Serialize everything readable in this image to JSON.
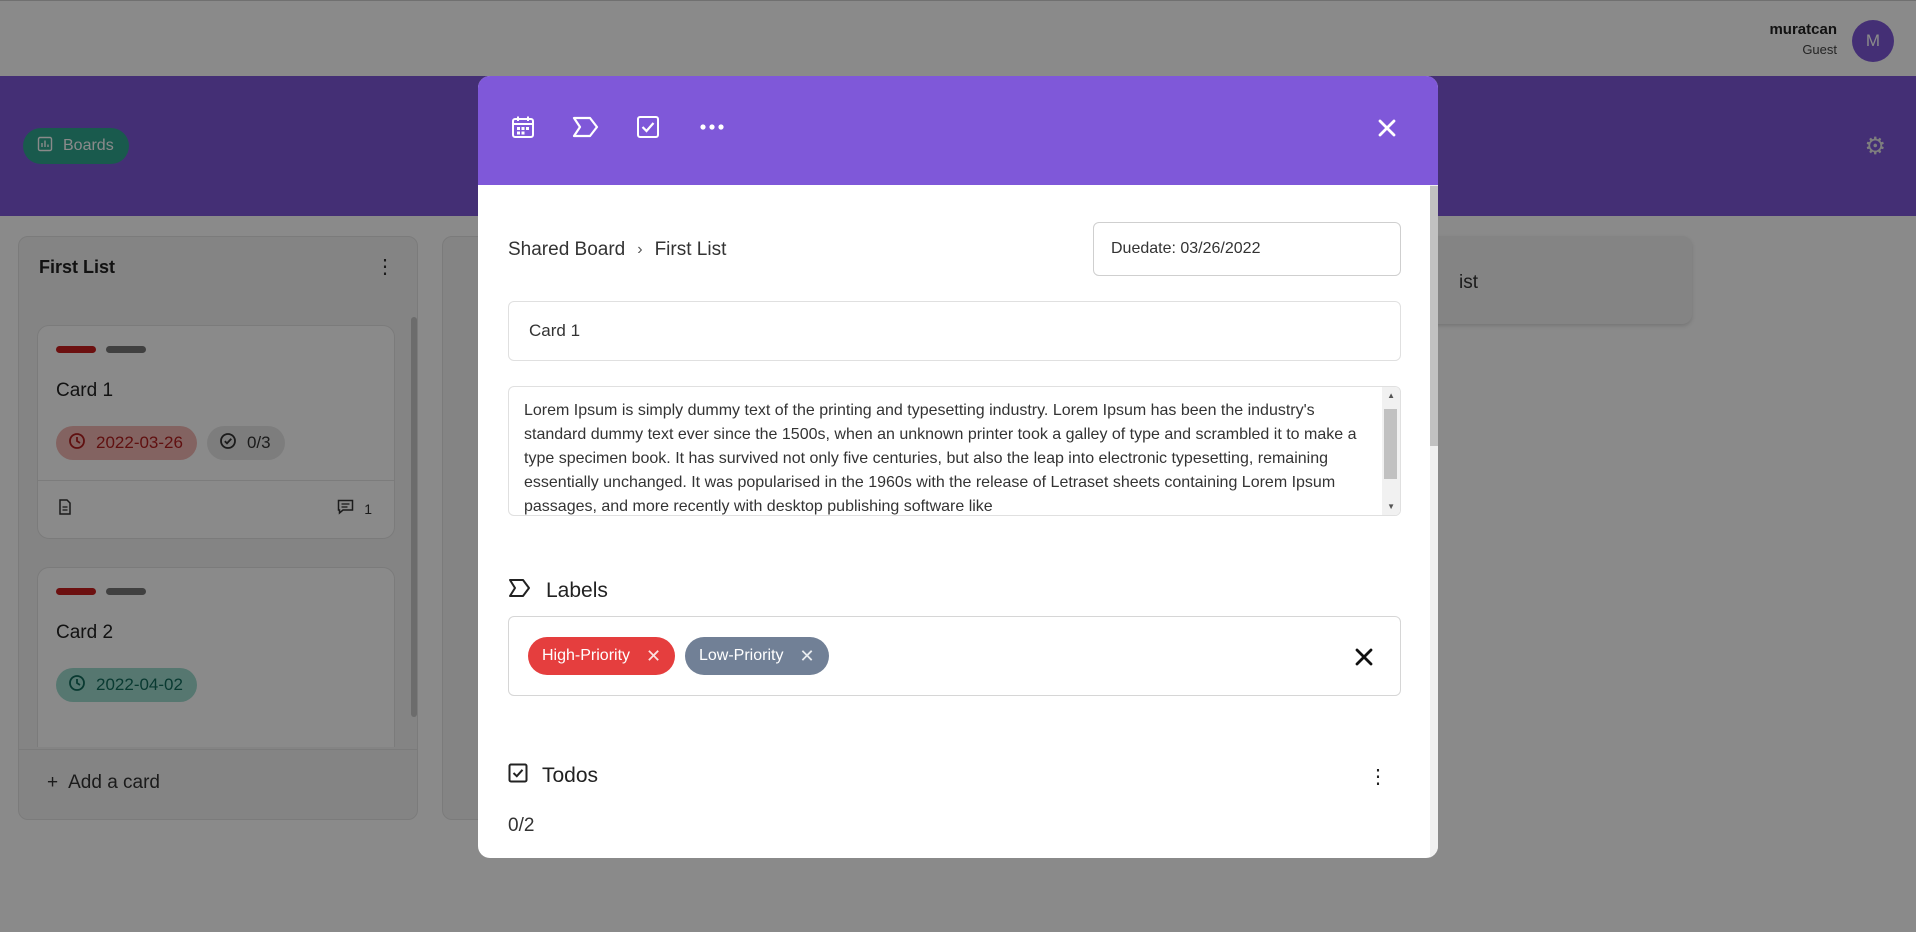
{
  "user": {
    "name": "muratcan",
    "role": "Guest",
    "initial": "M"
  },
  "board_header": {
    "boards_label": "Boards"
  },
  "lists": [
    {
      "title": "First List",
      "cards": [
        {
          "title": "Card 1",
          "due": "2022-03-26",
          "todos": "0/3",
          "comments": "1"
        },
        {
          "title": "Card 2",
          "due": "2022-04-02"
        }
      ],
      "add_card_label": "Add a card"
    }
  ],
  "add_list": {
    "label": "ist"
  },
  "modal": {
    "breadcrumb": {
      "board": "Shared Board",
      "separator": "›",
      "list": "First List"
    },
    "duedate": "Duedate: 03/26/2022",
    "card_title": "Card 1",
    "description": "Lorem Ipsum is simply dummy text of the printing and typesetting industry. Lorem Ipsum has been the industry's standard dummy text ever since the 1500s, when an unknown printer took a galley of type and scrambled it to make a type specimen book. It has survived not only five centuries, but also the leap into electronic typesetting, remaining essentially unchanged. It was popularised in the 1960s with the release of Letraset sheets containing Lorem Ipsum passages, and more recently with desktop publishing software like",
    "labels_heading": "Labels",
    "labels": [
      {
        "name": "High-Priority",
        "color": "#e53e3e"
      },
      {
        "name": "Low-Priority",
        "color": "#718096"
      }
    ],
    "todos_heading": "Todos",
    "todos_progress": "0/2"
  },
  "colors": {
    "accent": "#7f58d9",
    "boards_button": "#2fa68f",
    "high_priority": "#e53e3e",
    "low_priority": "#718096"
  },
  "icons": {
    "header": [
      "calendar-icon",
      "label-icon",
      "checkbox-icon",
      "more-horizontal-icon",
      "close-icon"
    ],
    "boards_button": "chart-icon",
    "settings": "gear-icon"
  }
}
